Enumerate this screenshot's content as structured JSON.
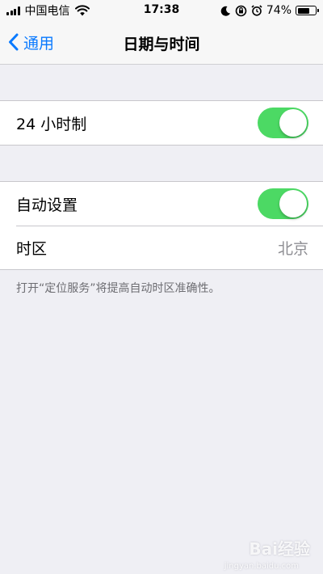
{
  "status_bar": {
    "carrier": "中国电信",
    "time": "17:38",
    "battery_percent": "74%",
    "battery_level": 0.74,
    "icons": [
      "signal-icon",
      "wifi-icon",
      "moon-icon",
      "rotation-lock-icon",
      "alarm-icon",
      "battery-icon"
    ]
  },
  "nav": {
    "back_label": "通用",
    "title": "日期与时间"
  },
  "groups": {
    "format": {
      "label_24h": "24 小时制",
      "toggle_24h_on": true
    },
    "auto": {
      "label_auto": "自动设置",
      "toggle_auto_on": true,
      "label_timezone": "时区",
      "timezone_value": "北京"
    }
  },
  "footer_note": "打开“定位服务”将提高自动时区准确性。",
  "watermark": {
    "logo": "Bai经验",
    "sub": "jingyan.baidu.com"
  },
  "colors": {
    "accent": "#0a7aff",
    "toggle_on": "#4cd964",
    "background": "#efeff4"
  }
}
